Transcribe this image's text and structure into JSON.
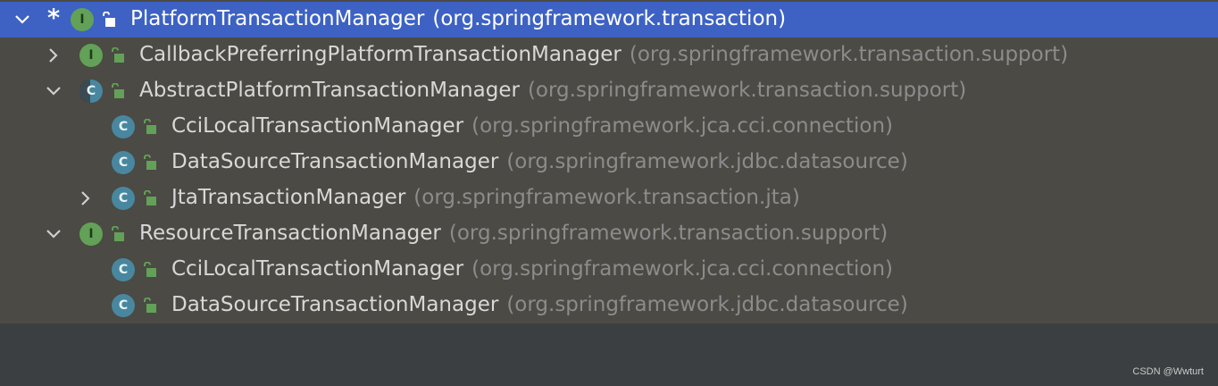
{
  "tree": {
    "rows": [
      {
        "marker": "*",
        "kind": "I",
        "name": "PlatformTransactionManager",
        "package": "(org.springframework.transaction)",
        "expander": "expanded",
        "selected": true
      },
      {
        "kind": "I",
        "name": "CallbackPreferringPlatformTransactionManager",
        "package": "(org.springframework.transaction.support)",
        "expander": "collapsed"
      },
      {
        "kind": "C",
        "abstract": true,
        "name": "AbstractPlatformTransactionManager",
        "package": "(org.springframework.transaction.support)",
        "expander": "expanded"
      },
      {
        "kind": "C",
        "name": "CciLocalTransactionManager",
        "package": "(org.springframework.jca.cci.connection)",
        "expander": "none"
      },
      {
        "kind": "C",
        "name": "DataSourceTransactionManager",
        "package": "(org.springframework.jdbc.datasource)",
        "expander": "none"
      },
      {
        "kind": "C",
        "name": "JtaTransactionManager",
        "package": "(org.springframework.transaction.jta)",
        "expander": "collapsed"
      },
      {
        "kind": "I",
        "name": "ResourceTransactionManager",
        "package": "(org.springframework.transaction.support)",
        "expander": "expanded"
      },
      {
        "kind": "C",
        "name": "CciLocalTransactionManager",
        "package": "(org.springframework.jca.cci.connection)",
        "expander": "none"
      },
      {
        "kind": "C",
        "name": "DataSourceTransactionManager",
        "package": "(org.springframework.jdbc.datasource)",
        "expander": "none"
      }
    ]
  },
  "icons": {
    "expanded": "chevron-down-icon",
    "collapsed": "chevron-right-icon",
    "interface": "interface-icon",
    "class": "class-icon",
    "abstract_class": "abstract-class-icon",
    "public": "public-access-lock-icon"
  },
  "colors": {
    "selection": "#3d62c4",
    "tree_background": "#4b4a44",
    "interface_badge": "#62a157",
    "class_badge": "#48879f",
    "lock": "#62a157",
    "package_text": "#8c8c8c"
  },
  "watermark": "CSDN @Wwturt"
}
